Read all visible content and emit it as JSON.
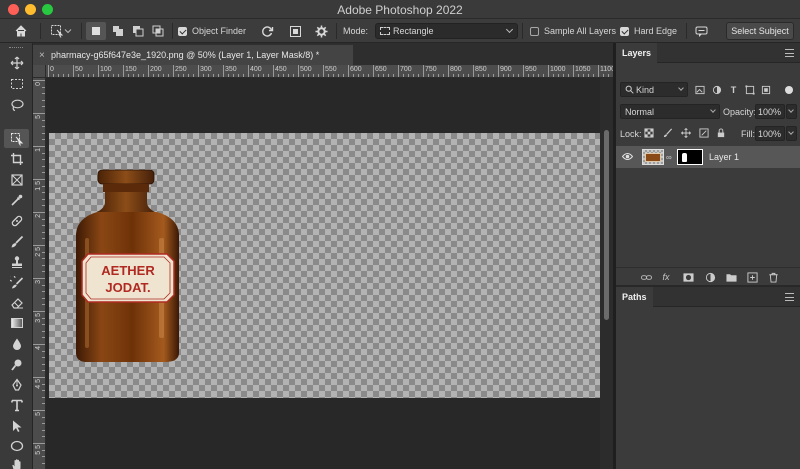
{
  "window": {
    "title": "Adobe Photoshop 2022"
  },
  "options": {
    "object_finder_label": "Object Finder",
    "object_finder_checked": true,
    "mode_label": "Mode:",
    "mode_value": "Rectangle",
    "sample_all_layers_label": "Sample All Layers",
    "sample_all_layers_checked": false,
    "hard_edge_label": "Hard Edge",
    "hard_edge_checked": true,
    "select_subject_label": "Select Subject"
  },
  "document": {
    "tab_title": "pharmacy-g65f647e3e_1920.png @ 50% (Layer 1, Layer Mask/8) *",
    "ruler_top": [
      "0",
      "50",
      "100",
      "150",
      "200",
      "250",
      "300",
      "350",
      "400",
      "450",
      "500",
      "550",
      "600",
      "650",
      "700",
      "750",
      "800",
      "850",
      "900",
      "950",
      "1000",
      "1050",
      "1100"
    ],
    "ruler_left": [
      "0",
      "5",
      "1",
      "1 5",
      "2",
      "2 5",
      "3",
      "3 5",
      "4",
      "4 5",
      "5",
      "5 5"
    ],
    "bottle_label_line1": "AETHER",
    "bottle_label_line2": "JODAT."
  },
  "tools": [
    "move-tool",
    "marquee-tool",
    "lasso-tool",
    "object-selection-tool",
    "crop-tool",
    "frame-tool",
    "eyedropper-tool",
    "healing-brush-tool",
    "brush-tool",
    "clone-stamp-tool",
    "history-brush-tool",
    "eraser-tool",
    "gradient-tool",
    "blur-tool",
    "dodge-tool",
    "pen-tool",
    "type-tool",
    "path-selection-tool",
    "ellipse-tool",
    "hand-tool"
  ],
  "layers_panel": {
    "tab_label": "Layers",
    "filter_kind": "Kind",
    "blend_mode": "Normal",
    "opacity_label": "Opacity:",
    "opacity_value": "100%",
    "lock_label": "Lock:",
    "fill_label": "Fill:",
    "fill_value": "100%",
    "layers": [
      {
        "name": "Layer 1",
        "visible": true,
        "has_mask": true
      }
    ]
  },
  "paths_panel": {
    "tab_label": "Paths"
  },
  "colors": {
    "accent_red": "#b02a22",
    "bottle_amber": "#7a3a0e",
    "selected_layer_bg": "#575757"
  }
}
